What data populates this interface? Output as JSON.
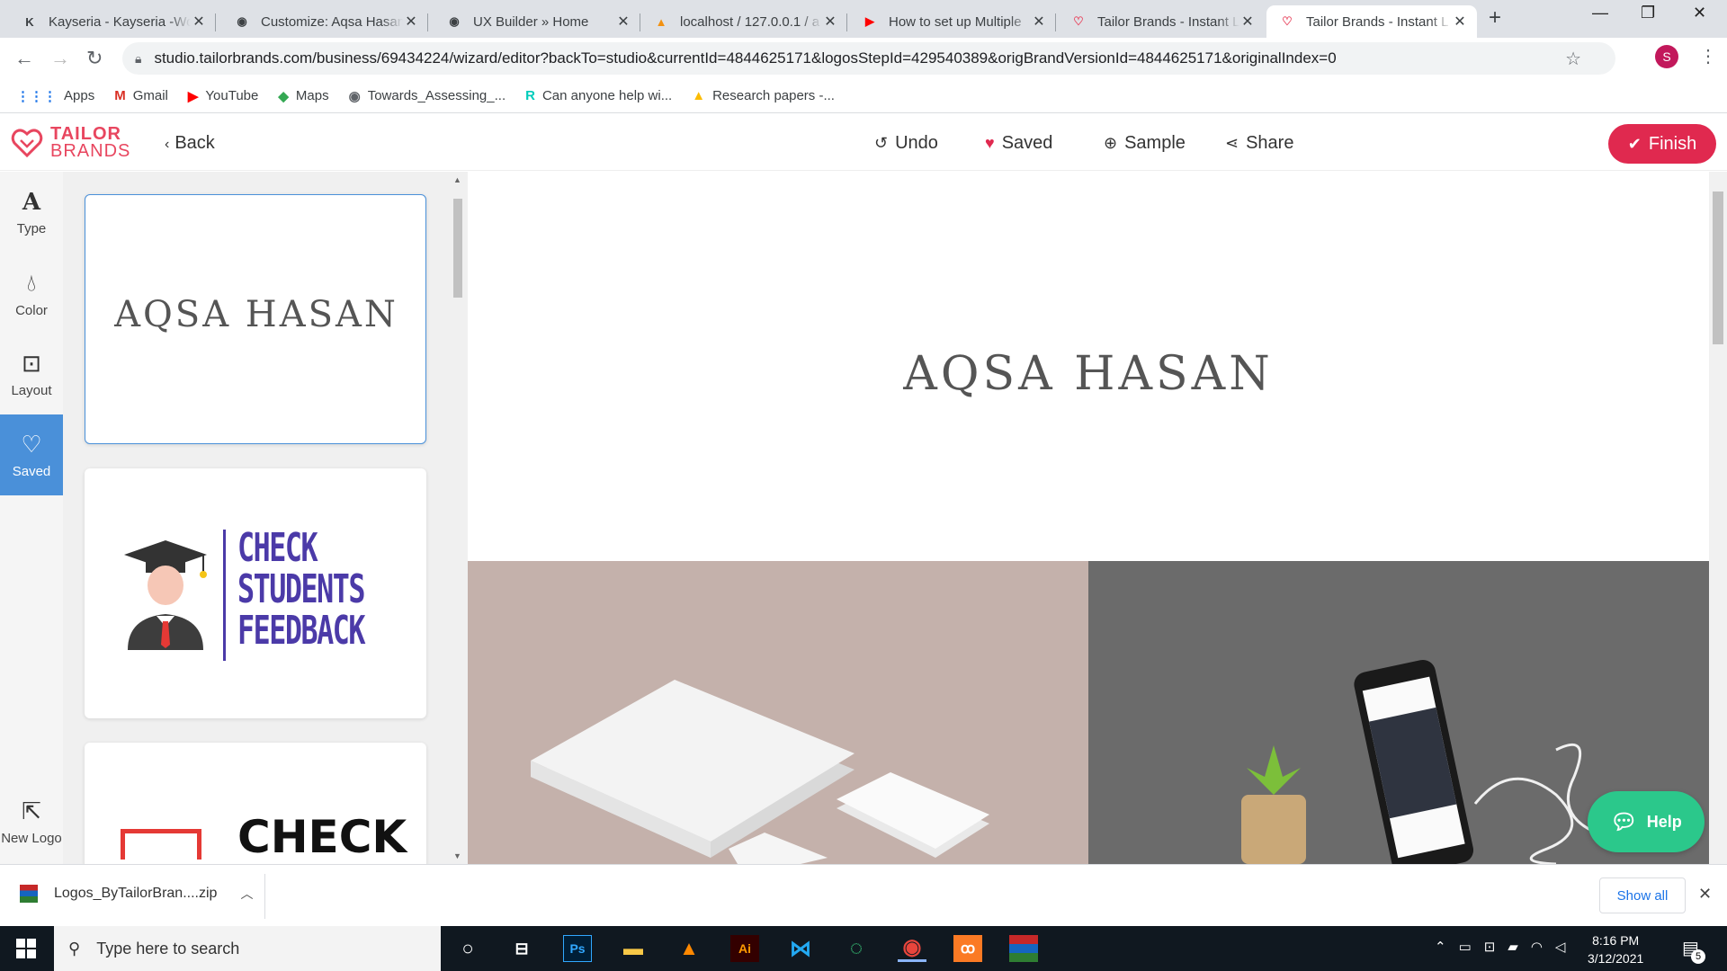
{
  "browser": {
    "tabs": [
      {
        "title": "Kayseria - Kayseria -Wo",
        "fav": "K",
        "favColor": "#222"
      },
      {
        "title": "Customize: Aqsa Hasan",
        "fav": "◉",
        "favColor": "#5f6368"
      },
      {
        "title": "UX Builder » Home",
        "fav": "◉",
        "favColor": "#5f6368"
      },
      {
        "title": "localhost / 127.0.0.1 / a",
        "fav": "▲",
        "favColor": "#f29111"
      },
      {
        "title": "How to set up Multiple",
        "fav": "▶",
        "favColor": "#ff0000"
      },
      {
        "title": "Tailor Brands - Instant L",
        "fav": "♡",
        "favColor": "#e8465f"
      },
      {
        "title": "Tailor Brands - Instant L",
        "fav": "♡",
        "favColor": "#e8465f"
      }
    ],
    "url": "studio.tailorbrands.com/business/69434224/wizard/editor?backTo=studio&currentId=4844625171&logosStepId=429540389&origBrandVersionId=4844625171&originalIndex=0",
    "profile_initial": "S",
    "bookmarks": [
      {
        "label": "Apps",
        "icon": "⋮⋮⋮",
        "color": "#1a73e8"
      },
      {
        "label": "Gmail",
        "icon": "M",
        "color": "#d93025"
      },
      {
        "label": "YouTube",
        "icon": "▶",
        "color": "#ff0000"
      },
      {
        "label": "Maps",
        "icon": "◆",
        "color": "#34a853"
      },
      {
        "label": "Towards_Assessing_...",
        "icon": "◉",
        "color": "#5f6368"
      },
      {
        "label": "Can anyone help wi...",
        "icon": "R",
        "color": "#00ccbb"
      },
      {
        "label": "Research papers -...",
        "icon": "▲",
        "color": "#fbbc04"
      }
    ]
  },
  "app": {
    "brand_line1": "TAILOR",
    "brand_line2": "BRANDS",
    "back_label": "Back",
    "actions": {
      "undo": "Undo",
      "saved": "Saved",
      "sample": "Sample",
      "share": "Share"
    },
    "finish_label": "Finish",
    "left_nav": {
      "type": "Type",
      "color": "Color",
      "layout": "Layout",
      "saved": "Saved",
      "new_logo": "New Logo"
    },
    "cards": [
      {
        "text": "AQSA HASAN"
      },
      {
        "lines": [
          "CHECK",
          "STUDENTS",
          "FEEDBACK"
        ]
      },
      {
        "text": "CHECK"
      }
    ],
    "canvas_brand": "AQSA HASAN",
    "help_label": "Help",
    "colors": {
      "accent": "#e0294f",
      "nav_active": "#4a90d9",
      "help": "#2bc88b",
      "mockup_left": "#c4b1ab",
      "mockup_right": "#6b6b6b",
      "logo_purple": "#4b3aa8"
    }
  },
  "download": {
    "file": "Logos_ByTailorBran....zip",
    "show_all": "Show all"
  },
  "taskbar": {
    "search_placeholder": "Type here to search",
    "time": "8:16 PM",
    "date": "3/12/2021",
    "notifications": "5"
  }
}
